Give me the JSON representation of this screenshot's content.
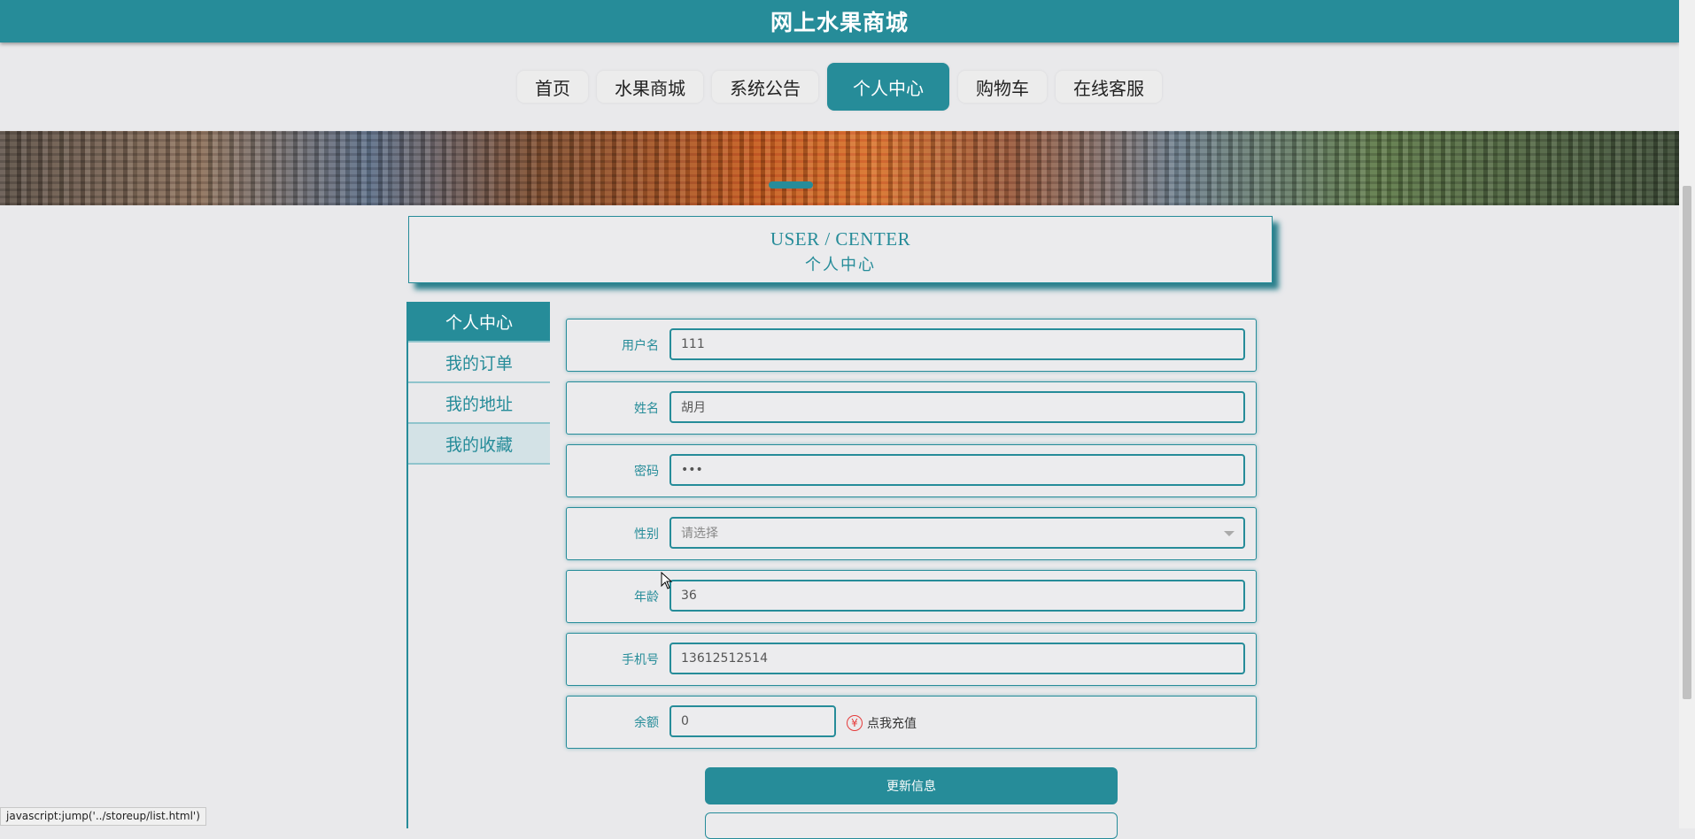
{
  "app": {
    "title": "网上水果商城"
  },
  "nav": {
    "items": [
      {
        "label": "首页"
      },
      {
        "label": "水果商城"
      },
      {
        "label": "系统公告"
      },
      {
        "label": "个人中心"
      },
      {
        "label": "购物车"
      },
      {
        "label": "在线客服"
      }
    ],
    "active": "个人中心"
  },
  "header": {
    "en": "USER / CENTER",
    "cn": "个人中心"
  },
  "sidebar": {
    "items": [
      {
        "label": "个人中心"
      },
      {
        "label": "我的订单"
      },
      {
        "label": "我的地址"
      },
      {
        "label": "我的收藏"
      }
    ]
  },
  "form": {
    "username": {
      "label": "用户名",
      "value": "111"
    },
    "name": {
      "label": "姓名",
      "value": "胡月"
    },
    "password": {
      "label": "密码",
      "value": "•••"
    },
    "gender": {
      "label": "性别",
      "placeholder": "请选择"
    },
    "age": {
      "label": "年龄",
      "value": "36"
    },
    "phone": {
      "label": "手机号",
      "value": "13612512514"
    },
    "balance": {
      "label": "余额",
      "value": "0",
      "recharge_icon": "¥",
      "recharge_label": "点我充值"
    }
  },
  "actions": {
    "update_label": "更新信息"
  },
  "status": {
    "url": "javascript:jump('../storeup/list.html')"
  },
  "colors": {
    "accent": "#268c99",
    "background": "#e9e9eb",
    "recharge": "#e53b3b"
  }
}
